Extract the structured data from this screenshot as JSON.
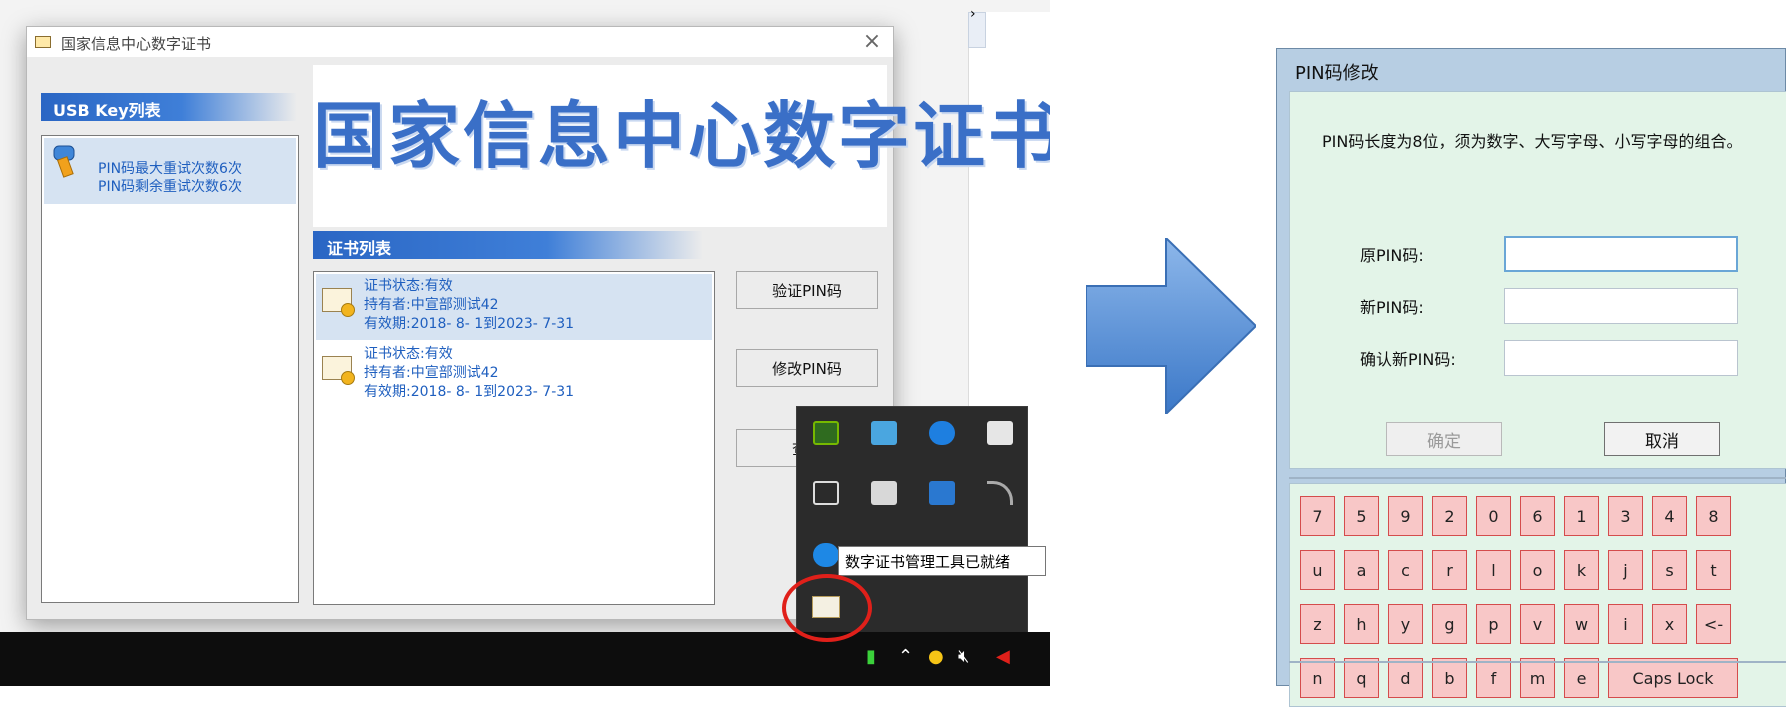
{
  "left": {
    "window": {
      "title": "国家信息中心数字证书",
      "usb_header": "USB Key列表",
      "usb_item": [
        "PIN码最大重试次数6次",
        "PIN码剩余重试次数6次"
      ],
      "banner": "国家信息中心数字证书",
      "cert_header": "证书列表",
      "certs": [
        {
          "status": "证书状态:有效",
          "holder": "持有者:中宣部测试42",
          "validity": "有效期:2018- 8- 1到2023- 7-31"
        },
        {
          "status": "证书状态:有效",
          "holder": "持有者:中宣部测试42",
          "validity": "有效期:2018- 8- 1到2023- 7-31"
        }
      ],
      "buttons": {
        "verify": "验证PIN码",
        "modify": "修改PIN码",
        "view": "查看"
      }
    },
    "tray_tooltip": "数字证书管理工具已就绪",
    "desktop_arrow": "›"
  },
  "pin_dialog": {
    "title": "PIN码修改",
    "description": "PIN码长度为8位，须为数字、大写字母、小写字母的组合。",
    "labels": {
      "old": "原PIN码:",
      "new": "新PIN码:",
      "confirm": "确认新PIN码:"
    },
    "values": {
      "old": "",
      "new": "",
      "confirm": ""
    },
    "ok_label": "确定",
    "cancel_label": "取消",
    "keypad_rows": [
      [
        "7",
        "5",
        "9",
        "2",
        "0",
        "6",
        "1",
        "3",
        "4",
        "8"
      ],
      [
        "u",
        "a",
        "c",
        "r",
        "l",
        "o",
        "k",
        "j",
        "s",
        "t"
      ],
      [
        "z",
        "h",
        "y",
        "g",
        "p",
        "v",
        "w",
        "i",
        "x",
        "<-"
      ],
      [
        "n",
        "q",
        "d",
        "b",
        "f",
        "m",
        "e",
        "Caps Lock"
      ]
    ]
  },
  "colors": {
    "accent_blue": "#2a66c4",
    "highlight": "#e0201a",
    "key_fill": "#f8c7c7",
    "key_border": "#d44c4c"
  }
}
